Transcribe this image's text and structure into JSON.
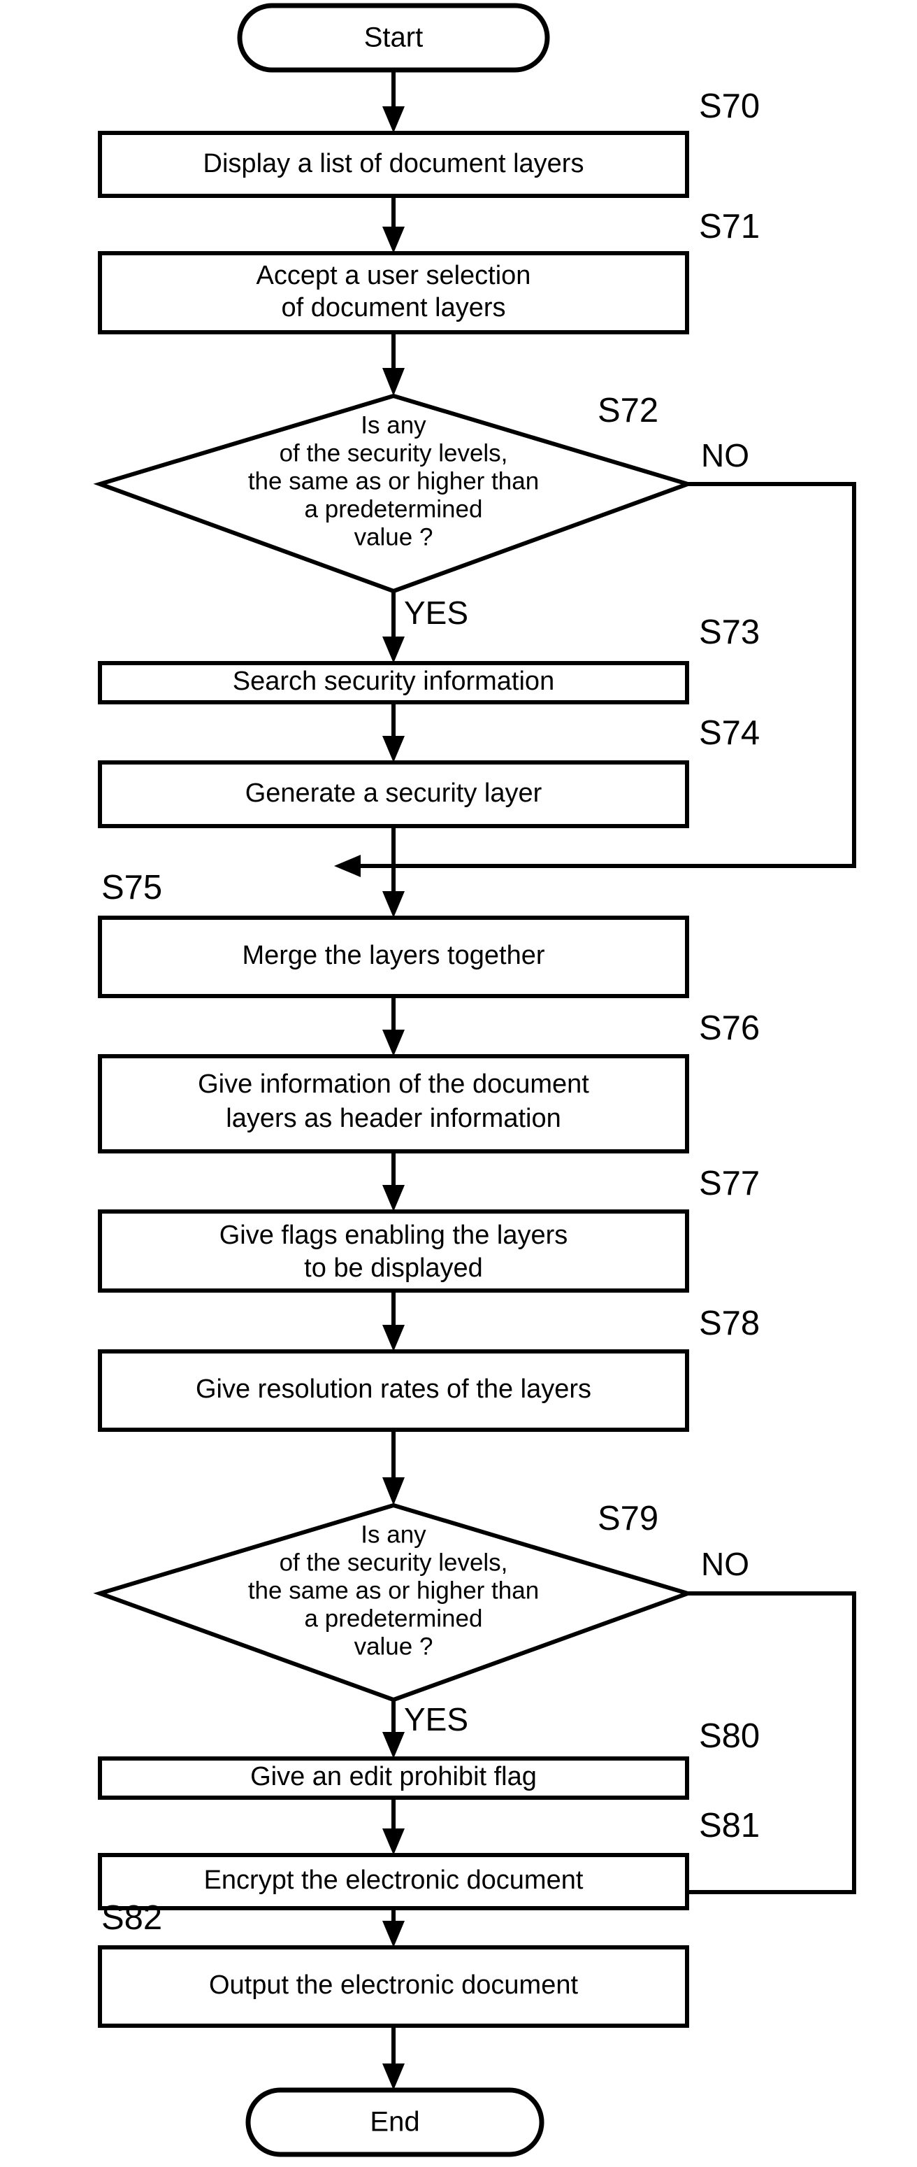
{
  "diagram": {
    "type": "flowchart",
    "title": "",
    "orientation": "vertical"
  },
  "terminals": {
    "start": "Start",
    "end": "End"
  },
  "branch_labels": {
    "yes": "YES",
    "no": "NO"
  },
  "nodes": [
    {
      "id": "start",
      "shape": "terminal",
      "step": "",
      "text": "Start"
    },
    {
      "id": "s70",
      "shape": "process",
      "step": "S70",
      "lines": [
        "Display a list of document layers"
      ]
    },
    {
      "id": "s71",
      "shape": "process",
      "step": "S71",
      "lines": [
        "Accept a user selection",
        "of document layers"
      ]
    },
    {
      "id": "s72",
      "shape": "decision",
      "step": "S72",
      "lines": [
        "Is any",
        "of the security levels,",
        "the same as or higher than",
        "a predetermined",
        "value ?"
      ],
      "yes": "YES",
      "no": "NO"
    },
    {
      "id": "s73",
      "shape": "process",
      "step": "S73",
      "lines": [
        "Search security information"
      ]
    },
    {
      "id": "s74",
      "shape": "process",
      "step": "S74",
      "lines": [
        "Generate a security layer"
      ]
    },
    {
      "id": "s75",
      "shape": "process",
      "step": "S75",
      "lines": [
        "Merge the layers together"
      ]
    },
    {
      "id": "s76",
      "shape": "process",
      "step": "S76",
      "lines": [
        "Give information of the document",
        "layers as header information"
      ]
    },
    {
      "id": "s77",
      "shape": "process",
      "step": "S77",
      "lines": [
        "Give flags enabling the layers",
        "to be displayed"
      ]
    },
    {
      "id": "s78",
      "shape": "process",
      "step": "S78",
      "lines": [
        "Give resolution rates of the layers"
      ]
    },
    {
      "id": "s79",
      "shape": "decision",
      "step": "S79",
      "lines": [
        "Is any",
        "of the security levels,",
        "the same as or higher than",
        "a predetermined",
        "value ?"
      ],
      "yes": "YES",
      "no": "NO"
    },
    {
      "id": "s80",
      "shape": "process",
      "step": "S80",
      "lines": [
        "Give an edit prohibit flag"
      ]
    },
    {
      "id": "s81",
      "shape": "process",
      "step": "S81",
      "lines": [
        "Encrypt the electronic document"
      ]
    },
    {
      "id": "s82",
      "shape": "process",
      "step": "S82",
      "lines": [
        "Output the electronic document"
      ]
    },
    {
      "id": "end",
      "shape": "terminal",
      "step": "",
      "text": "End"
    }
  ],
  "text": {
    "start": "Start",
    "end": "End",
    "s70_l1": "Display a list of document layers",
    "s71_l1": "Accept a user selection",
    "s71_l2": "of document layers",
    "s72_l1": "Is any",
    "s72_l2": "of the security levels,",
    "s72_l3": "the same as or higher than",
    "s72_l4": "a predetermined",
    "s72_l5": "value ?",
    "s73_l1": "Search security information",
    "s74_l1": "Generate a security layer",
    "s75_l1": "Merge the layers together",
    "s76_l1": "Give information of the document",
    "s76_l2": "layers as header information",
    "s77_l1": "Give flags enabling the layers",
    "s77_l2": "to be displayed",
    "s78_l1": "Give resolution rates of the layers",
    "s79_l1": "Is any",
    "s79_l2": "of the security levels,",
    "s79_l3": "the same as or higher than",
    "s79_l4": "a predetermined",
    "s79_l5": "value ?",
    "s80_l1": "Give an edit prohibit flag",
    "s81_l1": "Encrypt the electronic document",
    "s82_l1": "Output the electronic document"
  },
  "labels": {
    "s70": "S70",
    "s71": "S71",
    "s72": "S72",
    "s73": "S73",
    "s74": "S74",
    "s75": "S75",
    "s76": "S76",
    "s77": "S77",
    "s78": "S78",
    "s79": "S79",
    "s80": "S80",
    "s81": "S81",
    "s82": "S82",
    "yes_1": "YES",
    "no_1": "NO",
    "yes_2": "YES",
    "no_2": "NO"
  },
  "colors": {
    "stroke": "#000000",
    "fill": "#ffffff",
    "text": "#000000",
    "background": "#ffffff"
  }
}
